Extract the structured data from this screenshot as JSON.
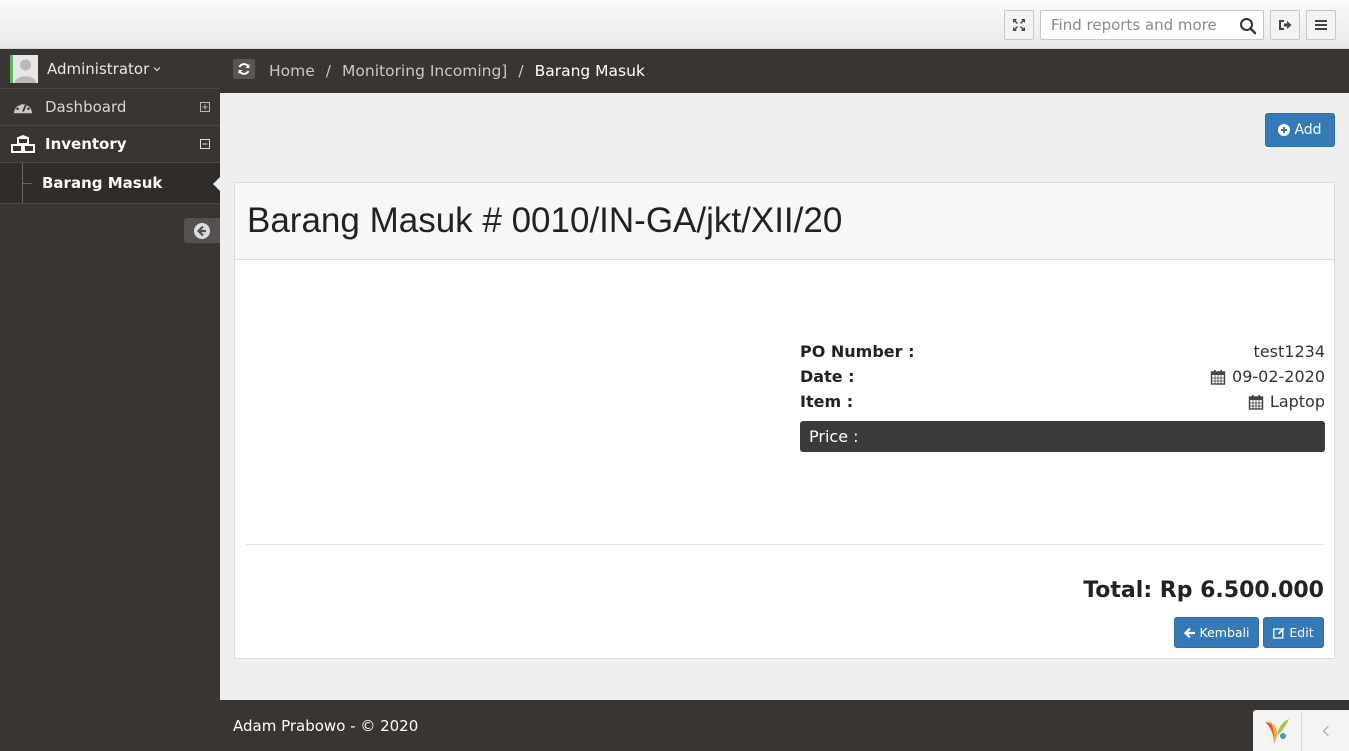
{
  "topbar": {
    "search_placeholder": "Find reports and more",
    "icons": [
      "fullscreen-icon",
      "search-icon",
      "logout-icon",
      "menu-icon"
    ]
  },
  "sidebar": {
    "user": "Administrator",
    "items": [
      {
        "label": "Dashboard",
        "icon": "dashboard-icon",
        "expanded": false
      },
      {
        "label": "Inventory",
        "icon": "cubes-icon",
        "expanded": true
      }
    ],
    "sub_items": [
      {
        "label": "Barang Masuk"
      }
    ]
  },
  "breadcrumb": {
    "home": "Home",
    "parent": "Monitoring Incoming]",
    "sep": "/",
    "current": "Barang Masuk"
  },
  "main": {
    "add_label": "Add",
    "title": "Barang Masuk # 0010/IN-GA/jkt/XII/20",
    "details": {
      "po_label": "PO Number :",
      "po_value": "test1234",
      "date_label": "Date :",
      "date_value": "09-02-2020",
      "item_label": "Item :",
      "item_value": "Laptop"
    },
    "price_label": "Price :",
    "total": "Total: Rp 6.500.000",
    "back_label": "Kembali",
    "edit_label": "Edit"
  },
  "footer": {
    "text": "Adam Prabowo - © 2020"
  },
  "colors": {
    "primary": "#337ab7",
    "sidebar_bg": "#383532",
    "accent_green": "#5cb85c"
  }
}
